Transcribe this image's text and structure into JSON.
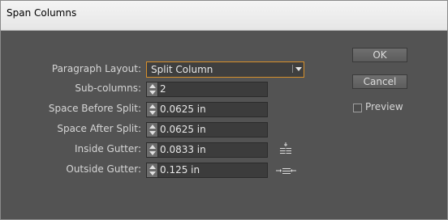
{
  "window": {
    "title": "Span Columns"
  },
  "form": {
    "paragraph_layout": {
      "label": "Paragraph Layout:",
      "value": "Split Column"
    },
    "sub_columns": {
      "label": "Sub-columns:",
      "value": "2"
    },
    "space_before": {
      "label": "Space Before Split:",
      "value": "0.0625 in"
    },
    "space_after": {
      "label": "Space After Split:",
      "value": "0.0625 in"
    },
    "inside_gutter": {
      "label": "Inside Gutter:",
      "value": "0.0833 in"
    },
    "outside_gutter": {
      "label": "Outside Gutter:",
      "value": "0.125 in"
    }
  },
  "buttons": {
    "ok": "OK",
    "cancel": "Cancel"
  },
  "preview": {
    "label": "Preview",
    "checked": false
  },
  "colors": {
    "dialog_bg": "#535353",
    "field_bg": "#3c3c3c",
    "focus_border": "#d7902b"
  },
  "icons": {
    "inside_gutter": "inside-gutter-icon",
    "outside_gutter": "outside-gutter-icon"
  }
}
